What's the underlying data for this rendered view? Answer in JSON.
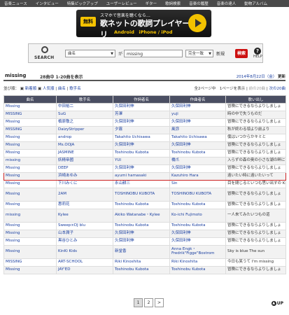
{
  "nav": [
    "音楽ニュース",
    "インタビュー",
    "特集ピックアップ",
    "ユーザーレビュー",
    "ギター",
    "歌詞検索",
    "音楽の履歴",
    "音楽の達人",
    "動物アルバム"
  ],
  "banner": {
    "badge": "無料",
    "line1": "スマホで音楽を聴くなら…",
    "line2": "歌ネットの歌詞プレイヤーアプリ",
    "line3": "Android　iPhone / iPod"
  },
  "search": {
    "logo_text": "SEARCH",
    "field": "曲名",
    "op_label": "が",
    "query": "missing",
    "match": "完全一致",
    "sort": "新規",
    "submit": "検索",
    "help": "HELP"
  },
  "result": {
    "query": "missing",
    "count_text": "28曲中 1-20曲を表示",
    "date": "2014年8月22日（金）",
    "update": "更新"
  },
  "sortbar": {
    "label": "並び順：",
    "options": [
      "新着順",
      "人気順",
      "曲名",
      "歌手名"
    ],
    "pages": "全2ページ中　1ページを表示",
    "prev": "前の20曲",
    "next": "次の20曲"
  },
  "table": {
    "headers": [
      "曲名",
      "歌手名",
      "作詞者名",
      "作曲者名",
      "歌い出し"
    ],
    "rows": [
      [
        "Missing",
        "中田裕二",
        "久保田利伸",
        "久保田利伸",
        "冒険にできるならよりしましょ"
      ],
      [
        "MISSING",
        "SuG",
        "芳澤",
        "yuji",
        "時の中で失うものだ"
      ],
      [
        "Missing",
        "槙原敬之",
        "久保田利伸",
        "久保田利伸",
        "冒険にできるならよりしましょ"
      ],
      [
        "MISSING",
        "DaizyStripper",
        "夕霧",
        "風弥",
        "秋が終わる頃より前より"
      ],
      [
        "Missing",
        "androp",
        "Takahito Uchisawa",
        "Takahito Uchisawa",
        "僕はいつからかキミと"
      ],
      [
        "Missing",
        "Ms.OOJA",
        "久保田利伸",
        "久保田利伸",
        "冒険にできるならよりしましょ"
      ],
      [
        "Missing",
        "JASMINE",
        "Toshinobu Kubota",
        "Toshinobu Kubota",
        "冒険にできるならよりしましょ"
      ],
      [
        "missing",
        "妖精帝國",
        "YUI",
        "橋爪",
        "入らずの森の奥の小さな湖の畔に"
      ],
      [
        "Missing",
        "DEEP",
        "久保田利伸",
        "久保田利伸",
        "冒険にできるならよりしましょ"
      ],
      [
        "Missing",
        "浜崎あゆみ",
        "ayumi hamasaki",
        "Kazuhiro Hara",
        "遠いたい時に遠いたいって"
      ],
      [
        "Missing",
        "下川みくに",
        "永山耕三",
        "Sin",
        "目を閉じるといつも思い出すの Kiss"
      ],
      [
        "Missing",
        "2AM",
        "TOSHINOBU KUBOTA",
        "TOSHINOBU KUBOTA",
        "冒険にできるならよりしましょ"
      ],
      [
        "Missing",
        "惠莉花",
        "Toshinobu Kubota",
        "Toshinobu Kubota",
        "冒険にできるならよりしましょ"
      ],
      [
        "missing",
        "Kylee",
        "Akiko Watanabe・Kylee",
        "Ko-ichi Fujimoto",
        "一人來てみたいつもの道"
      ],
      [
        "Missing",
        "Sweep×DJ blu",
        "Toshinobu Kubota",
        "Toshinobu Kubota",
        "冒険にできるならよりしましょ"
      ],
      [
        "Missing",
        "山本潤子",
        "久保田利伸",
        "久保田利伸",
        "冒険にできるならよりしましょ"
      ],
      [
        "Missing",
        "黒谷ひとみ",
        "久保田利伸",
        "久保田利伸",
        "冒険にできるならよりしましょ"
      ],
      [
        "Missing",
        "KinKi Kids",
        "新堂香",
        "Anna Engk・Fredrik\"Figge\"Bostrom",
        "Sky is blue The sun"
      ],
      [
        "MISSING",
        "ART-SCHOOL",
        "Riki Kinoshita",
        "Riki Kinoshita",
        "今日も笑うて I'm missing"
      ],
      [
        "Missing",
        "JAY'ED",
        "Toshinobu Kubota",
        "Toshinobu Kubota",
        "冒険にできるならよりしましょ"
      ]
    ]
  },
  "pager": [
    "1",
    "2",
    ">"
  ],
  "up_label": "UP"
}
